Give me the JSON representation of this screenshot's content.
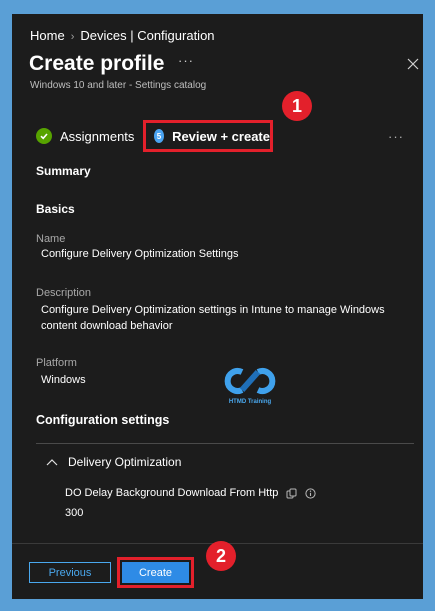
{
  "breadcrumb": {
    "home": "Home",
    "devices_configuration": "Devices | Configuration"
  },
  "header": {
    "title": "Create profile",
    "more": "···",
    "subtitle": "Windows 10 and later - Settings catalog"
  },
  "tabs": {
    "assignments_label": "Assignments",
    "review_label": "Review + create",
    "review_step_number": "5",
    "more": "···"
  },
  "callouts": {
    "badge_1": "1",
    "badge_2": "2"
  },
  "summary": {
    "heading": "Summary",
    "basics_heading": "Basics",
    "name_label": "Name",
    "name_value": "Configure Delivery Optimization Settings",
    "description_label": "Description",
    "description_value": "Configure Delivery Optimization settings in Intune to manage Windows content download behavior",
    "platform_label": "Platform",
    "platform_value": "Windows",
    "config_heading": "Configuration settings",
    "group_label": "Delivery Optimization",
    "setting_name": "DO Delay Background Download From Http",
    "setting_value": "300"
  },
  "watermark": {
    "text": "HTMD Training"
  },
  "footer": {
    "previous_label": "Previous",
    "create_label": "Create"
  },
  "colors": {
    "background": "#1c1c1c",
    "accent": "#2e8be6",
    "callout_red": "#e3202b",
    "check_green": "#57a300"
  }
}
